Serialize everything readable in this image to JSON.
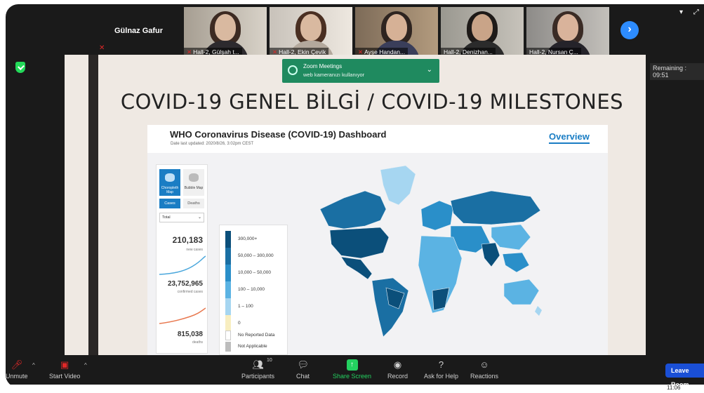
{
  "meeting": {
    "active_speaker": "Gülnaz Gafur",
    "remaining": "Remaining : 09:51"
  },
  "thumbnails": [
    {
      "label": "Hall-2, Gülşah t..."
    },
    {
      "label": "Hall-2, Ekin Çevik"
    },
    {
      "label": "Ayşe Handan..."
    },
    {
      "label": "Hall-2, Denizhan..."
    },
    {
      "label": "Hall-2, Nursan Ç..."
    }
  ],
  "toast": {
    "title": "Zoom Meetings",
    "message": "web kameranızı kullanıyor"
  },
  "slide": {
    "title": "COVID-19 GENEL BİLGİ / COVID-19 MILESTONES"
  },
  "dashboard": {
    "title": "WHO Coronavirus Disease (COVID-19) Dashboard",
    "updated": "Date last updated: 2020/8/26, 3:02pm CEST",
    "overview": "Overview",
    "choropleth": "Choropleth Map",
    "bubble": "Bubble Map",
    "tab_cases": "Cases",
    "tab_deaths": "Deaths",
    "select": "Total",
    "new_cases_value": "210,183",
    "new_cases_label": "new cases",
    "confirmed_value": "23,752,965",
    "confirmed_label": "confirmed cases",
    "deaths_value": "815,038",
    "deaths_label": "deaths",
    "legend": [
      {
        "label": "300,000+",
        "color": "#0b4f7a"
      },
      {
        "label": "50,000 – 300,000",
        "color": "#1a6fa3"
      },
      {
        "label": "10,000 – 50,000",
        "color": "#2a8fc9"
      },
      {
        "label": "100 – 10,000",
        "color": "#5bb3e3"
      },
      {
        "label": "1 – 100",
        "color": "#a6d6f1"
      },
      {
        "label": "0",
        "color": "#f8eec0"
      },
      {
        "label": "No Reported Data",
        "color": "#ffffff"
      },
      {
        "label": "Not Applicable",
        "color": "#bdbdbd"
      }
    ]
  },
  "toolbar": {
    "unmute": "Unmute",
    "start_video": "Start Video",
    "participants": "Participants",
    "participants_count": "10",
    "chat": "Chat",
    "share_screen": "Share Screen",
    "record": "Record",
    "ask_for_help": "Ask for Help",
    "reactions": "Reactions",
    "leave_room": "Leave Room"
  },
  "clock": "11:06"
}
